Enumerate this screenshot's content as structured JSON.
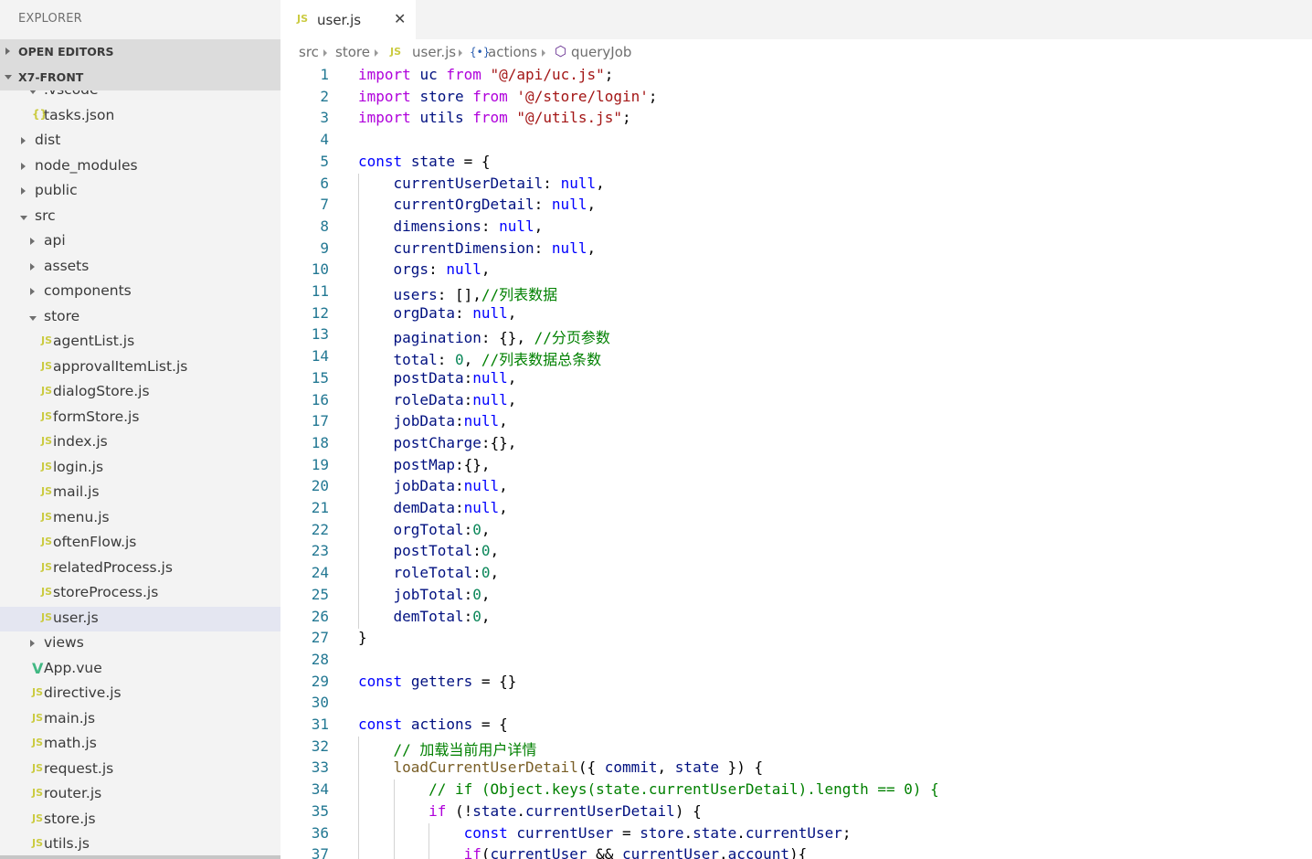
{
  "explorer": {
    "title": "EXPLORER",
    "open_editors_label": "OPEN EDITORS",
    "project_label": "X7-FRONT"
  },
  "tree": [
    {
      "label": ".vscode",
      "type": "folder-open",
      "depth": 1
    },
    {
      "label": "tasks.json",
      "type": "json",
      "depth": 1
    },
    {
      "label": "dist",
      "type": "folder",
      "depth": 0
    },
    {
      "label": "node_modules",
      "type": "folder",
      "depth": 0
    },
    {
      "label": "public",
      "type": "folder",
      "depth": 0
    },
    {
      "label": "src",
      "type": "folder-open",
      "depth": 0
    },
    {
      "label": "api",
      "type": "folder",
      "depth": 1
    },
    {
      "label": "assets",
      "type": "folder",
      "depth": 1
    },
    {
      "label": "components",
      "type": "folder",
      "depth": 1
    },
    {
      "label": "store",
      "type": "folder-open",
      "depth": 1
    },
    {
      "label": "agentList.js",
      "type": "js",
      "depth": 2
    },
    {
      "label": "approvalItemList.js",
      "type": "js",
      "depth": 2
    },
    {
      "label": "dialogStore.js",
      "type": "js",
      "depth": 2
    },
    {
      "label": "formStore.js",
      "type": "js",
      "depth": 2
    },
    {
      "label": "index.js",
      "type": "js",
      "depth": 2
    },
    {
      "label": "login.js",
      "type": "js",
      "depth": 2
    },
    {
      "label": "mail.js",
      "type": "js",
      "depth": 2
    },
    {
      "label": "menu.js",
      "type": "js",
      "depth": 2
    },
    {
      "label": "oftenFlow.js",
      "type": "js",
      "depth": 2
    },
    {
      "label": "relatedProcess.js",
      "type": "js",
      "depth": 2
    },
    {
      "label": "storeProcess.js",
      "type": "js",
      "depth": 2
    },
    {
      "label": "user.js",
      "type": "js",
      "depth": 2,
      "selected": true
    },
    {
      "label": "views",
      "type": "folder",
      "depth": 1
    },
    {
      "label": "App.vue",
      "type": "vue",
      "depth": 1
    },
    {
      "label": "directive.js",
      "type": "js",
      "depth": 1
    },
    {
      "label": "main.js",
      "type": "js",
      "depth": 1
    },
    {
      "label": "math.js",
      "type": "js",
      "depth": 1
    },
    {
      "label": "request.js",
      "type": "js",
      "depth": 1
    },
    {
      "label": "router.js",
      "type": "js",
      "depth": 1
    },
    {
      "label": "store.js",
      "type": "js",
      "depth": 1
    },
    {
      "label": "utils.js",
      "type": "js",
      "depth": 1
    }
  ],
  "tab": {
    "icon": "JS",
    "label": "user.js",
    "close": "✕"
  },
  "breadcrumb": {
    "items": [
      "src",
      "store",
      "user.js",
      "actions",
      "queryJob"
    ]
  },
  "icons": {
    "js": "JS",
    "json": "{}",
    "vue": "V",
    "module": "{•}",
    "method": "⬡"
  },
  "colors": {
    "keyword": "#0000ff",
    "import_keyword": "#af00db",
    "string": "#a31515",
    "identifier": "#001080",
    "comment": "#008000",
    "number": "#098658",
    "function": "#795e26",
    "line_number": "#237893",
    "js_icon": "#cbcb41",
    "vue_icon": "#41b883"
  },
  "code_lines": [
    {
      "n": 1,
      "indent": 0,
      "t": [
        [
          "kw2",
          "import"
        ],
        [
          "pl",
          " "
        ],
        [
          "id",
          "uc"
        ],
        [
          "pl",
          " "
        ],
        [
          "kw2",
          "from"
        ],
        [
          "pl",
          " "
        ],
        [
          "str",
          "\"@/api/uc.js\""
        ],
        [
          "pl",
          ";"
        ]
      ]
    },
    {
      "n": 2,
      "indent": 0,
      "t": [
        [
          "kw2",
          "import"
        ],
        [
          "pl",
          " "
        ],
        [
          "id",
          "store"
        ],
        [
          "pl",
          " "
        ],
        [
          "kw2",
          "from"
        ],
        [
          "pl",
          " "
        ],
        [
          "str",
          "'@/store/login'"
        ],
        [
          "pl",
          ";"
        ]
      ]
    },
    {
      "n": 3,
      "indent": 0,
      "t": [
        [
          "kw2",
          "import"
        ],
        [
          "pl",
          " "
        ],
        [
          "id",
          "utils"
        ],
        [
          "pl",
          " "
        ],
        [
          "kw2",
          "from"
        ],
        [
          "pl",
          " "
        ],
        [
          "str",
          "\"@/utils.js\""
        ],
        [
          "pl",
          ";"
        ]
      ]
    },
    {
      "n": 4,
      "indent": 0,
      "t": []
    },
    {
      "n": 5,
      "indent": 0,
      "t": [
        [
          "kw",
          "const"
        ],
        [
          "pl",
          " "
        ],
        [
          "id",
          "state"
        ],
        [
          "pl",
          " = {"
        ]
      ]
    },
    {
      "n": 6,
      "indent": 1,
      "t": [
        [
          "pl",
          "    "
        ],
        [
          "id",
          "currentUserDetail"
        ],
        [
          "pl",
          ": "
        ],
        [
          "kw",
          "null"
        ],
        [
          "pl",
          ","
        ]
      ]
    },
    {
      "n": 7,
      "indent": 1,
      "t": [
        [
          "pl",
          "    "
        ],
        [
          "id",
          "currentOrgDetail"
        ],
        [
          "pl",
          ": "
        ],
        [
          "kw",
          "null"
        ],
        [
          "pl",
          ","
        ]
      ]
    },
    {
      "n": 8,
      "indent": 1,
      "t": [
        [
          "pl",
          "    "
        ],
        [
          "id",
          "dimensions"
        ],
        [
          "pl",
          ": "
        ],
        [
          "kw",
          "null"
        ],
        [
          "pl",
          ","
        ]
      ]
    },
    {
      "n": 9,
      "indent": 1,
      "t": [
        [
          "pl",
          "    "
        ],
        [
          "id",
          "currentDimension"
        ],
        [
          "pl",
          ": "
        ],
        [
          "kw",
          "null"
        ],
        [
          "pl",
          ","
        ]
      ]
    },
    {
      "n": 10,
      "indent": 1,
      "t": [
        [
          "pl",
          "    "
        ],
        [
          "id",
          "orgs"
        ],
        [
          "pl",
          ": "
        ],
        [
          "kw",
          "null"
        ],
        [
          "pl",
          ","
        ]
      ]
    },
    {
      "n": 11,
      "indent": 1,
      "t": [
        [
          "pl",
          "    "
        ],
        [
          "id",
          "users"
        ],
        [
          "pl",
          ": [],"
        ],
        [
          "cm",
          "//列表数据"
        ]
      ]
    },
    {
      "n": 12,
      "indent": 1,
      "t": [
        [
          "pl",
          "    "
        ],
        [
          "id",
          "orgData"
        ],
        [
          "pl",
          ": "
        ],
        [
          "kw",
          "null"
        ],
        [
          "pl",
          ","
        ]
      ]
    },
    {
      "n": 13,
      "indent": 1,
      "t": [
        [
          "pl",
          "    "
        ],
        [
          "id",
          "pagination"
        ],
        [
          "pl",
          ": {}, "
        ],
        [
          "cm",
          "//分页参数"
        ]
      ]
    },
    {
      "n": 14,
      "indent": 1,
      "t": [
        [
          "pl",
          "    "
        ],
        [
          "id",
          "total"
        ],
        [
          "pl",
          ": "
        ],
        [
          "num",
          "0"
        ],
        [
          "pl",
          ", "
        ],
        [
          "cm",
          "//列表数据总条数"
        ]
      ]
    },
    {
      "n": 15,
      "indent": 1,
      "t": [
        [
          "pl",
          "    "
        ],
        [
          "id",
          "postData"
        ],
        [
          "pl",
          ":"
        ],
        [
          "kw",
          "null"
        ],
        [
          "pl",
          ","
        ]
      ]
    },
    {
      "n": 16,
      "indent": 1,
      "t": [
        [
          "pl",
          "    "
        ],
        [
          "id",
          "roleData"
        ],
        [
          "pl",
          ":"
        ],
        [
          "kw",
          "null"
        ],
        [
          "pl",
          ","
        ]
      ]
    },
    {
      "n": 17,
      "indent": 1,
      "t": [
        [
          "pl",
          "    "
        ],
        [
          "id",
          "jobData"
        ],
        [
          "pl",
          ":"
        ],
        [
          "kw",
          "null"
        ],
        [
          "pl",
          ","
        ]
      ]
    },
    {
      "n": 18,
      "indent": 1,
      "t": [
        [
          "pl",
          "    "
        ],
        [
          "id",
          "postCharge"
        ],
        [
          "pl",
          ":{},"
        ]
      ]
    },
    {
      "n": 19,
      "indent": 1,
      "t": [
        [
          "pl",
          "    "
        ],
        [
          "id",
          "postMap"
        ],
        [
          "pl",
          ":{},"
        ]
      ]
    },
    {
      "n": 20,
      "indent": 1,
      "t": [
        [
          "pl",
          "    "
        ],
        [
          "id",
          "jobData"
        ],
        [
          "pl",
          ":"
        ],
        [
          "kw",
          "null"
        ],
        [
          "pl",
          ","
        ]
      ]
    },
    {
      "n": 21,
      "indent": 1,
      "t": [
        [
          "pl",
          "    "
        ],
        [
          "id",
          "demData"
        ],
        [
          "pl",
          ":"
        ],
        [
          "kw",
          "null"
        ],
        [
          "pl",
          ","
        ]
      ]
    },
    {
      "n": 22,
      "indent": 1,
      "t": [
        [
          "pl",
          "    "
        ],
        [
          "id",
          "orgTotal"
        ],
        [
          "pl",
          ":"
        ],
        [
          "num",
          "0"
        ],
        [
          "pl",
          ","
        ]
      ]
    },
    {
      "n": 23,
      "indent": 1,
      "t": [
        [
          "pl",
          "    "
        ],
        [
          "id",
          "postTotal"
        ],
        [
          "pl",
          ":"
        ],
        [
          "num",
          "0"
        ],
        [
          "pl",
          ","
        ]
      ]
    },
    {
      "n": 24,
      "indent": 1,
      "t": [
        [
          "pl",
          "    "
        ],
        [
          "id",
          "roleTotal"
        ],
        [
          "pl",
          ":"
        ],
        [
          "num",
          "0"
        ],
        [
          "pl",
          ","
        ]
      ]
    },
    {
      "n": 25,
      "indent": 1,
      "t": [
        [
          "pl",
          "    "
        ],
        [
          "id",
          "jobTotal"
        ],
        [
          "pl",
          ":"
        ],
        [
          "num",
          "0"
        ],
        [
          "pl",
          ","
        ]
      ]
    },
    {
      "n": 26,
      "indent": 1,
      "t": [
        [
          "pl",
          "    "
        ],
        [
          "id",
          "demTotal"
        ],
        [
          "pl",
          ":"
        ],
        [
          "num",
          "0"
        ],
        [
          "pl",
          ","
        ]
      ]
    },
    {
      "n": 27,
      "indent": 0,
      "t": [
        [
          "pl",
          "}"
        ]
      ]
    },
    {
      "n": 28,
      "indent": 0,
      "t": []
    },
    {
      "n": 29,
      "indent": 0,
      "t": [
        [
          "kw",
          "const"
        ],
        [
          "pl",
          " "
        ],
        [
          "id",
          "getters"
        ],
        [
          "pl",
          " = {}"
        ]
      ]
    },
    {
      "n": 30,
      "indent": 0,
      "t": []
    },
    {
      "n": 31,
      "indent": 0,
      "t": [
        [
          "kw",
          "const"
        ],
        [
          "pl",
          " "
        ],
        [
          "id",
          "actions"
        ],
        [
          "pl",
          " = {"
        ]
      ]
    },
    {
      "n": 32,
      "indent": 1,
      "t": [
        [
          "pl",
          "    "
        ],
        [
          "cm",
          "// 加载当前用户详情"
        ]
      ]
    },
    {
      "n": 33,
      "indent": 1,
      "t": [
        [
          "pl",
          "    "
        ],
        [
          "fn",
          "loadCurrentUserDetail"
        ],
        [
          "pl",
          "({ "
        ],
        [
          "id",
          "commit"
        ],
        [
          "pl",
          ", "
        ],
        [
          "id",
          "state"
        ],
        [
          "pl",
          " }) {"
        ]
      ]
    },
    {
      "n": 34,
      "indent": 2,
      "t": [
        [
          "pl",
          "        "
        ],
        [
          "cm",
          "// if (Object.keys(state.currentUserDetail).length == 0) {"
        ]
      ]
    },
    {
      "n": 35,
      "indent": 2,
      "t": [
        [
          "pl",
          "        "
        ],
        [
          "kw2",
          "if"
        ],
        [
          "pl",
          " (!"
        ],
        [
          "id",
          "state"
        ],
        [
          "pl",
          "."
        ],
        [
          "id",
          "currentUserDetail"
        ],
        [
          "pl",
          ") {"
        ]
      ]
    },
    {
      "n": 36,
      "indent": 3,
      "t": [
        [
          "pl",
          "            "
        ],
        [
          "kw",
          "const"
        ],
        [
          "pl",
          " "
        ],
        [
          "id",
          "currentUser"
        ],
        [
          "pl",
          " = "
        ],
        [
          "id",
          "store"
        ],
        [
          "pl",
          "."
        ],
        [
          "id",
          "state"
        ],
        [
          "pl",
          "."
        ],
        [
          "id",
          "currentUser"
        ],
        [
          "pl",
          ";"
        ]
      ]
    },
    {
      "n": 37,
      "indent": 3,
      "t": [
        [
          "pl",
          "            "
        ],
        [
          "kw2",
          "if"
        ],
        [
          "pl",
          "("
        ],
        [
          "id",
          "currentUser"
        ],
        [
          "pl",
          " && "
        ],
        [
          "id",
          "currentUser"
        ],
        [
          "pl",
          "."
        ],
        [
          "id",
          "account"
        ],
        [
          "pl",
          "){"
        ]
      ]
    }
  ]
}
